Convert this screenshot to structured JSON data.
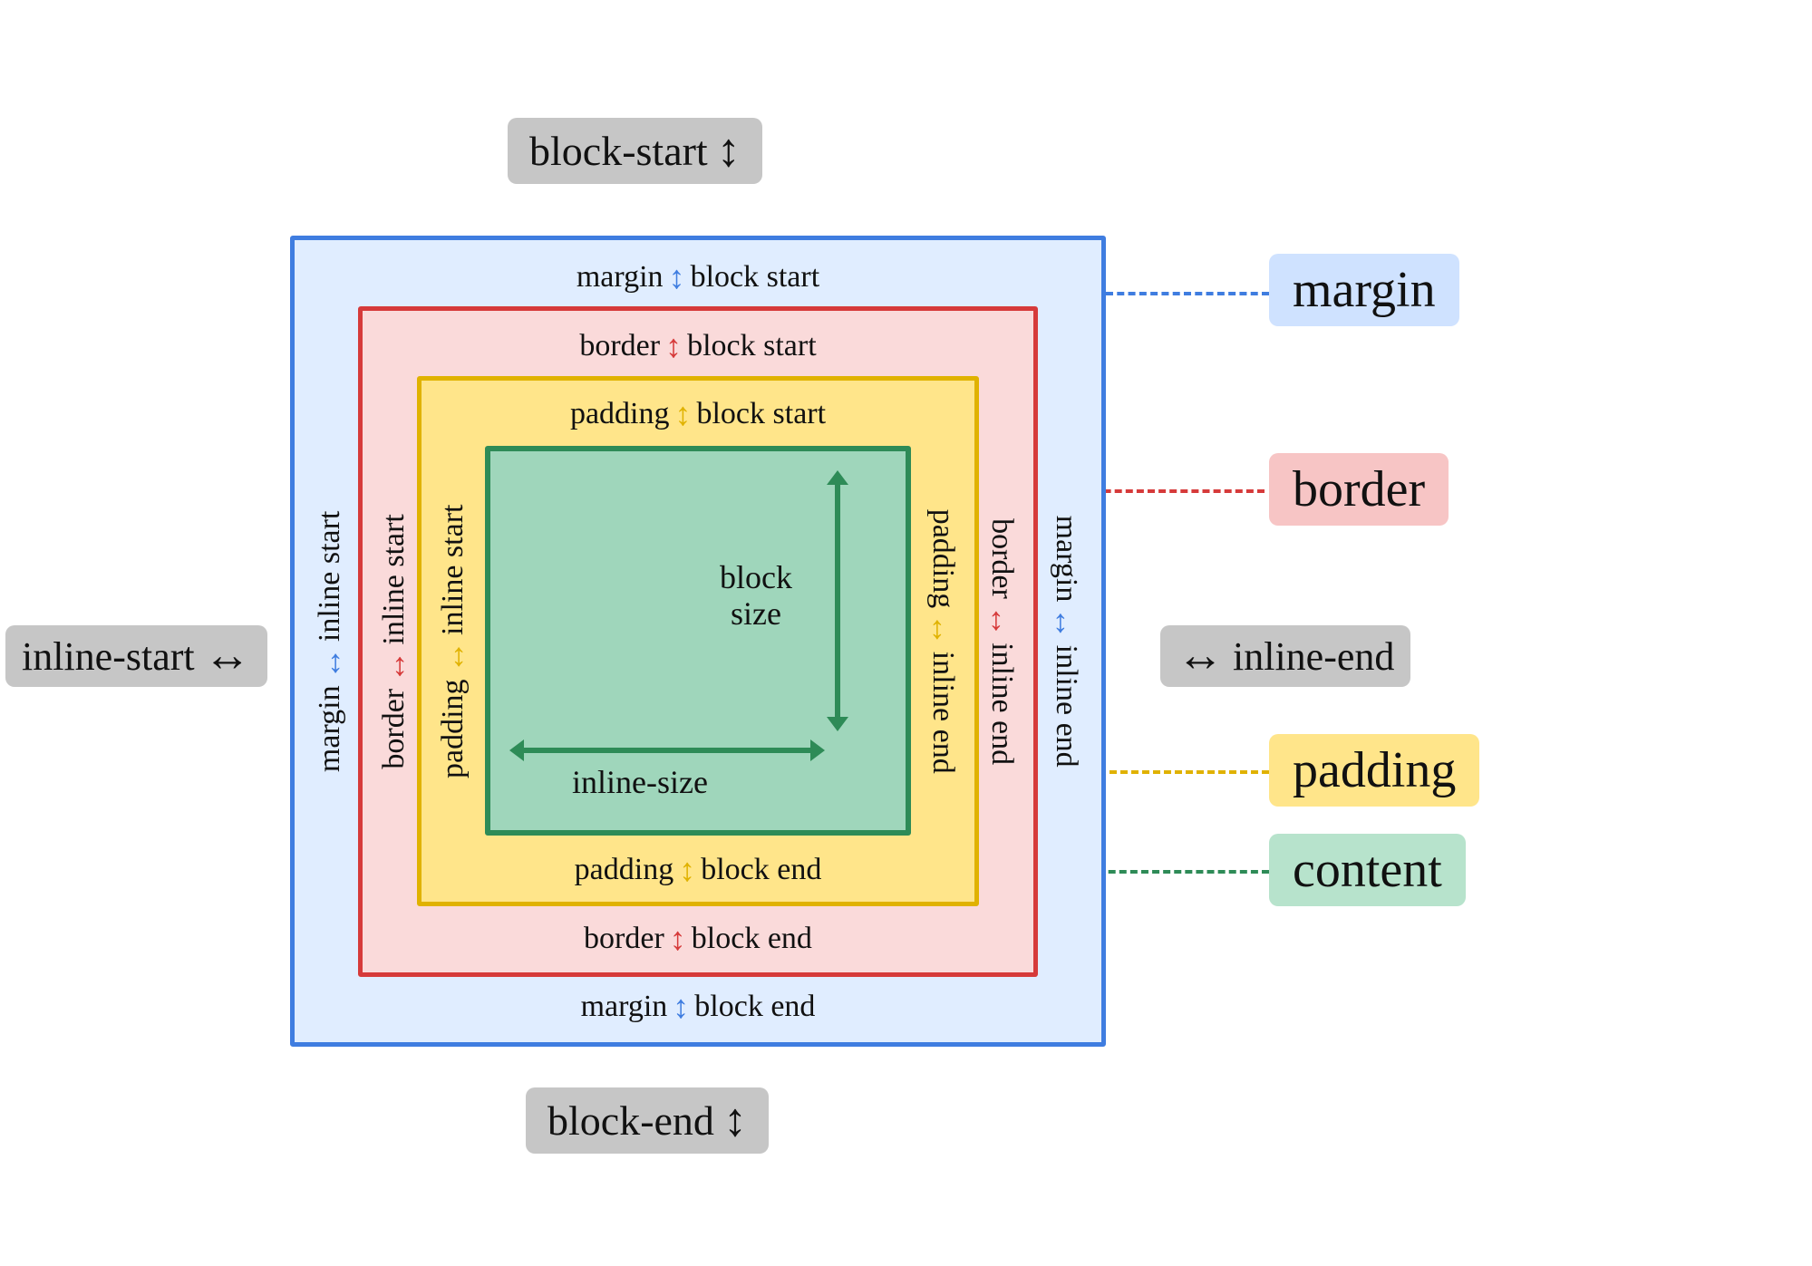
{
  "directions": {
    "block_start": "block-start",
    "block_end": "block-end",
    "inline_start": "inline-start",
    "inline_end": "inline-end"
  },
  "legend": {
    "margin": "margin",
    "border": "border",
    "padding": "padding",
    "content": "content"
  },
  "layers": {
    "margin": {
      "name": "margin",
      "top": {
        "left": "margin",
        "right": "block start"
      },
      "bottom": {
        "left": "margin",
        "right": "block end"
      },
      "left": {
        "top": "inline start",
        "bottom": "margin"
      },
      "right": {
        "top": "margin",
        "bottom": "inline end"
      }
    },
    "border": {
      "name": "border",
      "top": {
        "left": "border",
        "right": "block start"
      },
      "bottom": {
        "left": "border",
        "right": "block end"
      },
      "left": {
        "top": "inline start",
        "bottom": "border"
      },
      "right": {
        "top": "border",
        "bottom": "inline end"
      }
    },
    "padding": {
      "name": "padding",
      "top": {
        "left": "padding",
        "right": "block start"
      },
      "bottom": {
        "left": "padding",
        "right": "block end"
      },
      "left": {
        "top": "inline start",
        "bottom": "padding"
      },
      "right": {
        "top": "padding",
        "bottom": "inline end"
      }
    },
    "content": {
      "block_size": "block\nsize",
      "inline_size": "inline-size"
    }
  },
  "glyphs": {
    "updown": "↕",
    "leftright": "↔"
  }
}
